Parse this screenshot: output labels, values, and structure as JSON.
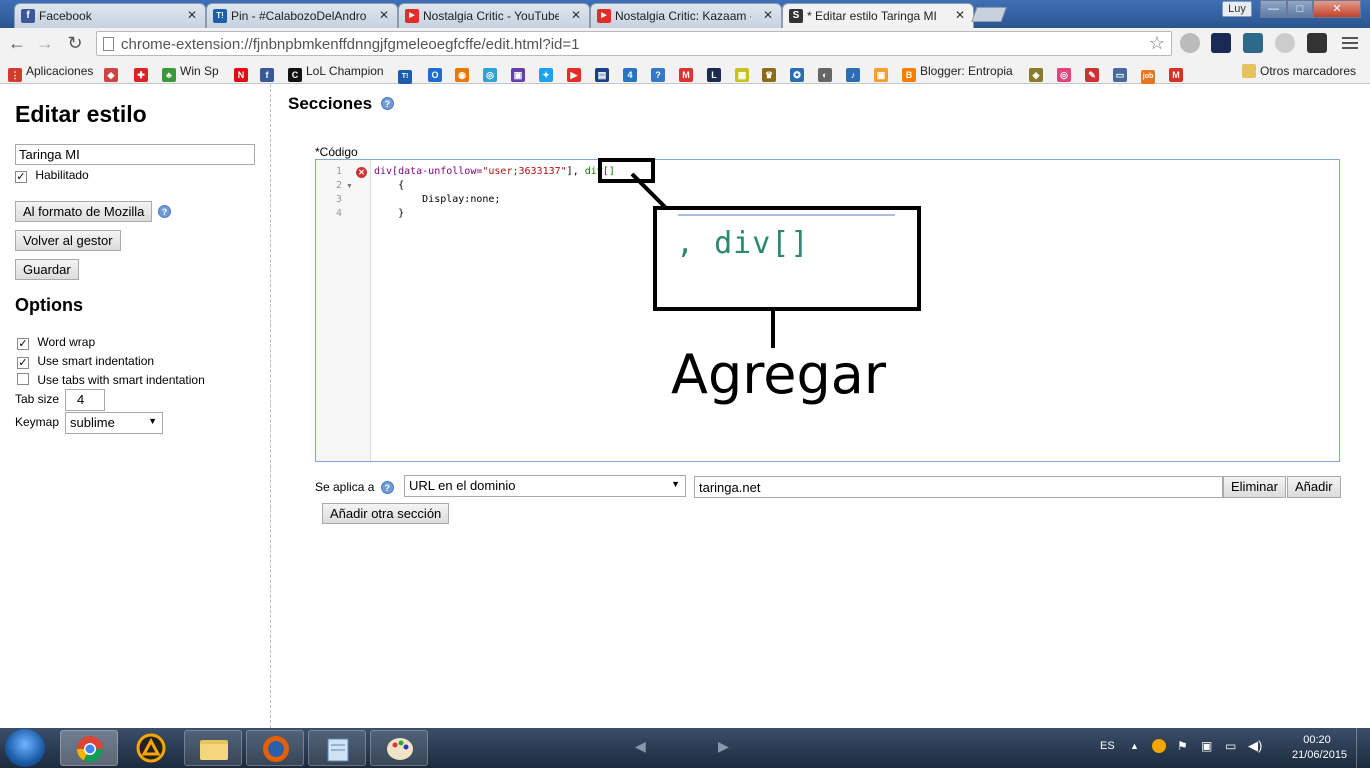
{
  "browser": {
    "tabs": [
      {
        "label": "Facebook",
        "icon": "facebook-icon",
        "color": "#3b5998",
        "glyph": "f"
      },
      {
        "label": "Pin - #CalabozoDelAndroi",
        "icon": "taringa-icon",
        "color": "#1d5ea8",
        "glyph": "T!"
      },
      {
        "label": "Nostalgia Critic - YouTube",
        "icon": "youtube-icon",
        "color": "#e52d27",
        "glyph": "▶"
      },
      {
        "label": "Nostalgia Critic: Kazaam -",
        "icon": "youtube-icon",
        "color": "#e52d27",
        "glyph": "▶"
      },
      {
        "label": "* Editar estilo Taringa MI",
        "icon": "stylish-icon",
        "color": "#333333",
        "glyph": "S"
      }
    ],
    "user": "Luy",
    "window": {
      "minimize": "—",
      "maximize": "□",
      "close": "✕"
    },
    "url": "chrome-extension://fjnbnpbmkenffdnngjfgmeleoegfcffe/edit.html?id=1",
    "bookmarks": [
      {
        "label": "Aplicaciones",
        "color": "#d23c2e",
        "glyph": "⋮"
      },
      {
        "label": "",
        "color": "#c44",
        "glyph": "◆"
      },
      {
        "label": "",
        "color": "#d22",
        "glyph": "✚"
      },
      {
        "label": "Win Sp",
        "color": "#3a9a3a",
        "glyph": "♣"
      },
      {
        "label": "",
        "color": "#e50914",
        "glyph": "N"
      },
      {
        "label": "",
        "color": "#3b5998",
        "glyph": "f"
      },
      {
        "label": "LoL Champion",
        "color": "#111",
        "glyph": "C"
      },
      {
        "label": "",
        "color": "#1d5ea8",
        "glyph": "T!"
      },
      {
        "label": "",
        "color": "#1c6fd1",
        "glyph": "O"
      },
      {
        "label": "",
        "color": "#e57a00",
        "glyph": "◉"
      },
      {
        "label": "",
        "color": "#2ea3d6",
        "glyph": "◎"
      },
      {
        "label": "",
        "color": "#6441a5",
        "glyph": "▣"
      },
      {
        "label": "",
        "color": "#1da1f2",
        "glyph": "✦"
      },
      {
        "label": "",
        "color": "#e52d27",
        "glyph": "▶"
      },
      {
        "label": "",
        "color": "#1b3f8b",
        "glyph": "▤"
      },
      {
        "label": "",
        "color": "#2874c5",
        "glyph": "4"
      },
      {
        "label": "",
        "color": "#3479c6",
        "glyph": "?"
      },
      {
        "label": "",
        "color": "#d33",
        "glyph": "M"
      },
      {
        "label": "",
        "color": "#1d2b50",
        "glyph": "L"
      },
      {
        "label": "",
        "color": "#c9c320",
        "glyph": "▦"
      },
      {
        "label": "",
        "color": "#8b6a1a",
        "glyph": "♛"
      },
      {
        "label": "",
        "color": "#2a6fb5",
        "glyph": "✪"
      },
      {
        "label": "",
        "color": "#666",
        "glyph": "◐"
      },
      {
        "label": "",
        "color": "#2a6fb5",
        "glyph": "♪"
      },
      {
        "label": "",
        "color": "#f0a030",
        "glyph": "▣"
      },
      {
        "label": "Blogger: Entropia",
        "color": "#f57d00",
        "glyph": "B"
      },
      {
        "label": "",
        "color": "#8b7a2a",
        "glyph": "◈"
      },
      {
        "label": "",
        "color": "#e2437b",
        "glyph": "◎"
      },
      {
        "label": "",
        "color": "#c33",
        "glyph": "✎"
      },
      {
        "label": "",
        "color": "#466a9a",
        "glyph": "▭"
      },
      {
        "label": "",
        "color": "#e87722",
        "glyph": "job"
      },
      {
        "label": "",
        "color": "#d93025",
        "glyph": "M"
      }
    ],
    "other_bookmarks": "Otros marcadores"
  },
  "sidebar": {
    "title": "Editar estilo",
    "style_name": "Taringa MI",
    "enabled_label": "Habilitado",
    "enabled": true,
    "mozilla_button": "Al formato de Mozilla",
    "back_button": "Volver al gestor",
    "save_button": "Guardar",
    "options_title": "Options",
    "options": {
      "word_wrap": {
        "label": "Word wrap",
        "checked": true
      },
      "smart_indent": {
        "label": "Use smart indentation",
        "checked": true
      },
      "tabs_smart": {
        "label": "Use tabs with smart indentation",
        "checked": false
      },
      "tab_size_label": "Tab size",
      "tab_size": "4",
      "keymap_label": "Keymap",
      "keymap": "sublime"
    }
  },
  "main": {
    "sections_title": "Secciones",
    "code_label": "*Código",
    "code_lines": [
      {
        "n": "1",
        "sel": "div[data-unfollow=",
        "str": "\"user;3633137\"",
        "rest": "], ",
        "tag": "div[]"
      },
      {
        "n": "2",
        "text": "    {"
      },
      {
        "n": "3",
        "text": "        Display:none;"
      },
      {
        "n": "4",
        "text": "    }"
      }
    ],
    "annotation_zoom": ", div[]",
    "annotation_label": "Agregar",
    "applies_label": "Se aplica a",
    "applies_select": "URL en el dominio",
    "applies_value": "taringa.net",
    "remove_button": "Eliminar",
    "add_button": "Añadir",
    "add_section_button": "Añadir otra sección"
  },
  "taskbar": {
    "lang": "ES",
    "time": "00:20",
    "date": "21/06/2015"
  }
}
